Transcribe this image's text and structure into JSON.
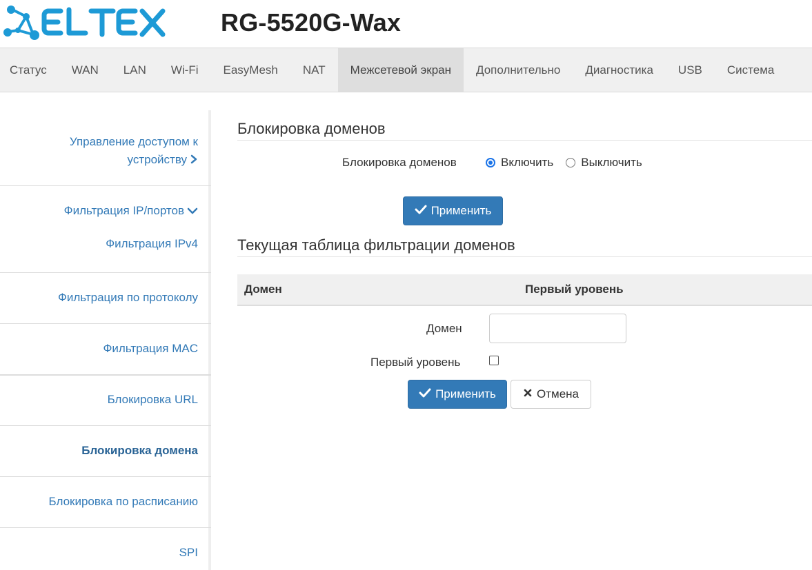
{
  "brand": {
    "logo_text": "ELTEX",
    "model": "RG-5520G-Wax",
    "logo_color": "#1d9ad6"
  },
  "topnav": {
    "items": [
      {
        "label": "Статус"
      },
      {
        "label": "WAN"
      },
      {
        "label": "LAN"
      },
      {
        "label": "Wi-Fi"
      },
      {
        "label": "EasyMesh"
      },
      {
        "label": "NAT"
      },
      {
        "label": "Межсетевой экран",
        "active": true
      },
      {
        "label": "Дополнительно"
      },
      {
        "label": "Диагностика"
      },
      {
        "label": "USB"
      },
      {
        "label": "Система"
      }
    ]
  },
  "sidebar": {
    "items": [
      {
        "label_line1": "Управление доступом к",
        "label_line2": "устройству",
        "icon": "chevron-right-icon"
      },
      {
        "label": "Фильтрация IP/портов",
        "icon": "chevron-down-icon",
        "sub_label": "Фильтрация IPv4"
      },
      {
        "label": "Фильтрация по протоколу"
      },
      {
        "label": "Фильтрация MAC"
      },
      {
        "label": "Блокировка URL"
      },
      {
        "label": "Блокировка домена",
        "active": true
      },
      {
        "label": "Блокировка по расписанию"
      },
      {
        "label": "SPI"
      }
    ]
  },
  "main": {
    "section1": {
      "title": "Блокировка доменов",
      "field_label": "Блокировка доменов",
      "radio_on_label": "Включить",
      "radio_off_label": "Выключить",
      "selected": "Включить",
      "apply_label": "Применить"
    },
    "section2": {
      "title": "Текущая таблица фильтрации доменов",
      "columns": [
        "Домен",
        "Первый уровень"
      ],
      "domain_label": "Домен",
      "domain_value": "",
      "first_level_label": "Первый уровень",
      "first_level_checked": false,
      "apply_label": "Применить",
      "cancel_label": "Отмена"
    }
  },
  "colors": {
    "accent": "#337ab7",
    "link": "#337ab7",
    "nav_bg": "#f0f0f0",
    "nav_active_bg": "#dedede"
  }
}
